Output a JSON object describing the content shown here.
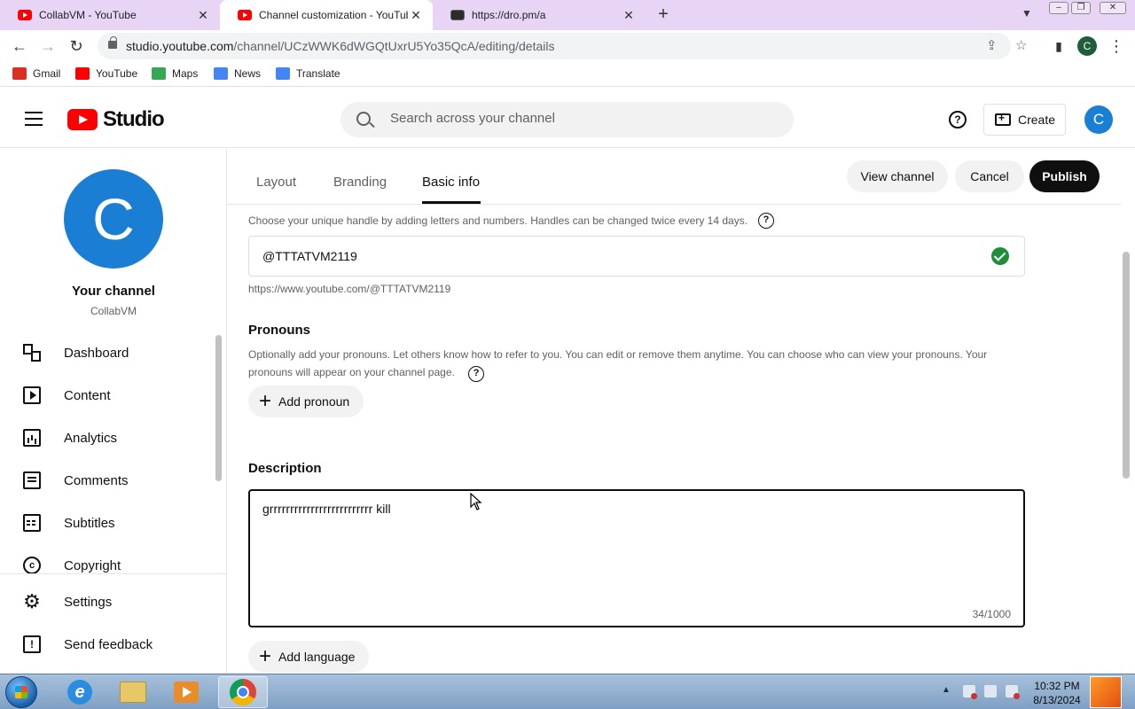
{
  "browser": {
    "tabs": [
      {
        "title": "CollabVM - YouTube",
        "icon": "youtube-favicon"
      },
      {
        "title": "Channel customization - YouTube Studio",
        "icon": "youtube-favicon"
      },
      {
        "title": "https://dro.pm/a",
        "icon": "terminal-favicon"
      }
    ],
    "close_glyph": "✕",
    "new_tab_glyph": "+",
    "url_host": "studio.youtube.com",
    "url_path": "/channel/UCzWWK6dWGQtUxrU5Yo35QcA/editing/details",
    "profile_initial": "C",
    "bookmarks": [
      {
        "label": "Gmail",
        "icon": "gmail-icon",
        "color": "#d93025"
      },
      {
        "label": "YouTube",
        "icon": "youtube-icon",
        "color": "#ff0000"
      },
      {
        "label": "Maps",
        "icon": "maps-icon",
        "color": "#34a853"
      },
      {
        "label": "News",
        "icon": "news-icon",
        "color": "#4285f4"
      },
      {
        "label": "Translate",
        "icon": "translate-icon",
        "color": "#4285f4"
      }
    ]
  },
  "header": {
    "logo_text": "Studio",
    "search_placeholder": "Search across your channel",
    "help_glyph": "?",
    "create_label": "Create",
    "avatar_initial": "C"
  },
  "sidebar": {
    "avatar_initial": "C",
    "your_channel": "Your channel",
    "channel_name": "CollabVM",
    "items": [
      {
        "label": "Dashboard",
        "icon": "dashboard-icon"
      },
      {
        "label": "Content",
        "icon": "content-icon"
      },
      {
        "label": "Analytics",
        "icon": "analytics-icon"
      },
      {
        "label": "Comments",
        "icon": "comments-icon"
      },
      {
        "label": "Subtitles",
        "icon": "subtitles-icon"
      },
      {
        "label": "Copyright",
        "icon": "copyright-icon"
      }
    ],
    "copyright_glyph": "c",
    "settings_label": "Settings",
    "feedback_label": "Send feedback",
    "feedback_glyph": "!"
  },
  "main": {
    "tabs": [
      {
        "label": "Layout"
      },
      {
        "label": "Branding"
      },
      {
        "label": "Basic info"
      }
    ],
    "view_channel_label": "View channel",
    "cancel_label": "Cancel",
    "publish_label": "Publish",
    "handle_hint": "Choose your unique handle by adding letters and numbers. Handles can be changed twice every 14 days.",
    "handle_value": "@TTTATVM2119",
    "handle_url": "https://www.youtube.com/@TTTATVM2119",
    "pronouns_title": "Pronouns",
    "pronouns_desc": "Optionally add your pronouns. Let others know how to refer to you. You can edit or remove them anytime. You can choose who can view your pronouns. Your pronouns will appear on your channel page.",
    "add_pronoun_label": "Add pronoun",
    "description_title": "Description",
    "description_value": "grrrrrrrrrrrrrrrrrrrrrrrrr kill ",
    "char_count": "34/1000",
    "add_language_label": "Add language",
    "question_glyph": "?",
    "plus_glyph": "+"
  },
  "taskbar": {
    "ie_glyph": "e",
    "time": "10:32 PM",
    "date": "8/13/2024",
    "tray_up_glyph": "▲"
  }
}
